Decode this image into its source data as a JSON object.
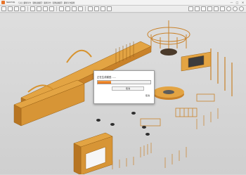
{
  "window": {
    "app_name": "SketchUp",
    "path_text": "· 与对上廣場平台（運動訓練区）廣場平台（運動訓練区）廣場平台廣場",
    "controls": [
      "—",
      "□",
      "✕"
    ]
  },
  "toolbar": {
    "left_icons": [
      "select-icon",
      "eraser-icon",
      "pencil-icon",
      "arc-icon",
      "rectangle-icon",
      "push-pull-icon",
      "move-icon",
      "rotate-icon",
      "scale-icon",
      "offset-icon",
      "tape-icon",
      "text-icon",
      "paint-icon",
      "orbit-icon",
      "pan-icon",
      "zoom-icon"
    ],
    "right_icons": [
      "iso-view-icon",
      "top-view-icon",
      "front-view-icon",
      "right-view-icon",
      "back-view-icon",
      "left-view-icon",
      "warehouse-icon",
      "extension-icon",
      "settings-icon"
    ]
  },
  "dialog": {
    "title": "正在生成模型……",
    "progress": 0.25,
    "cancel_label": "取消",
    "detail_label": "取消"
  },
  "colors": {
    "accent": "#e8742a",
    "model": "#e3a443",
    "viewport_bg": "#d7d7d7"
  }
}
